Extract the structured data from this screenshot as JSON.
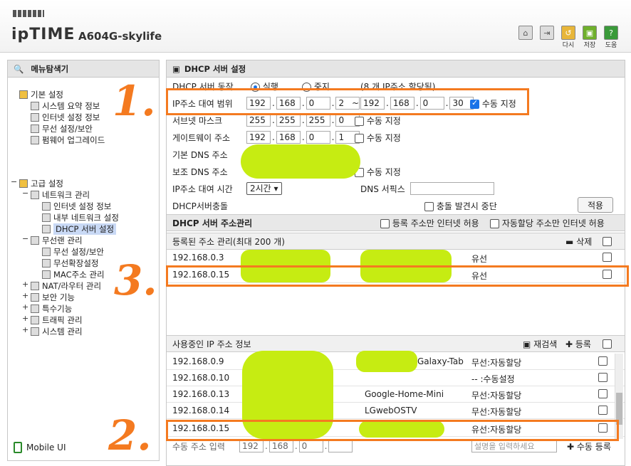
{
  "header": {
    "brand": "ipTIME",
    "model": "A604G-skylife",
    "icons": [
      "home-icon",
      "logout-icon"
    ],
    "buttons": [
      {
        "icon": "undo-icon",
        "label": "다시",
        "color": "#e8b63a"
      },
      {
        "icon": "save-icon",
        "label": "저장",
        "color": "#6fb02c"
      },
      {
        "icon": "help-icon",
        "label": "도움",
        "color": "#3a9a3a"
      }
    ]
  },
  "sidebar": {
    "title": "메뉴탐색기",
    "basic": {
      "label": "기본 설정",
      "items": [
        "시스템 요약 정보",
        "인터넷 설정 정보",
        "무선 설정/보안",
        "펌웨어 업그레이드"
      ]
    },
    "advanced": {
      "label": "고급 설정",
      "network": {
        "label": "네트워크 관리",
        "items": [
          "인터넷 설정 정보",
          "내부 네트워크 설정",
          "DHCP 서버 설정"
        ]
      },
      "wireless": {
        "label": "무선랜 관리",
        "items": [
          "무선 설정/보안",
          "무선확장설정",
          "MAC주소 관리"
        ]
      },
      "others": [
        "NAT/라우터 관리",
        "보안 기능",
        "특수기능",
        "트래픽 관리",
        "시스템 관리"
      ]
    },
    "mobile": "Mobile UI"
  },
  "dhcp": {
    "title": "DHCP 서버 설정",
    "server_label": "DHCP 서버 동작",
    "run": "실행",
    "stop": "중지",
    "assigned": "(8 개 IP주소 할당됨)",
    "range_label": "IP주소 대여 범위",
    "range_start": [
      "192",
      "168",
      "0",
      "2"
    ],
    "range_end": [
      "192",
      "168",
      "0",
      "30"
    ],
    "tilde": "~",
    "manual": "수동 지정",
    "subnet_label": "서브넷 마스크",
    "subnet": [
      "255",
      "255",
      "255",
      "0"
    ],
    "gateway_label": "게이트웨이 주소",
    "gateway": [
      "192",
      "168",
      "0",
      "1"
    ],
    "dns1_label": "기본 DNS 주소",
    "dns2_label": "보조 DNS 주소",
    "lease_label": "IP주소 대여 시간",
    "lease_value": "2시간",
    "dns_suffix_label": "DNS 서픽스",
    "conflict_label": "DHCP서버충돌",
    "conflict_stop": "충돌 발견시 중단",
    "apply": "적용"
  },
  "addr_mgmt": {
    "title": "DHCP 서버 주소관리",
    "allow_registered": "등록 주소만 인터넷 허용",
    "allow_auto": "자동할당 주소만 인터넷 허용",
    "registered_header": "등록된 주소 관리(최대 200 개)",
    "delete": "삭제",
    "registered": [
      {
        "ip": "192.168.0.3",
        "type": "유선"
      },
      {
        "ip": "192.168.0.15",
        "type": "유선"
      }
    ],
    "inuse_header": "사용중인 IP 주소 정보",
    "rescan": "재검색",
    "register": "등록",
    "inuse": [
      {
        "ip": "192.168.0.9",
        "name": "Galaxy-Tab",
        "type": "무선:자동할당"
      },
      {
        "ip": "192.168.0.10",
        "name": "",
        "type": "-- :수동설정"
      },
      {
        "ip": "192.168.0.13",
        "name": "Google-Home-Mini",
        "type": "무선:자동할당"
      },
      {
        "ip": "192.168.0.14",
        "name": "LGwebOSTV",
        "type": "무선:자동할당"
      },
      {
        "ip": "192.168.0.15",
        "name": "",
        "type": "유선:자동할당"
      }
    ],
    "manual_input_label": "수동 주소 입력",
    "manual_ip": [
      "192",
      "168",
      "0"
    ],
    "desc_placeholder": "설명을 입력하세요",
    "manual_register": "수동 등록"
  },
  "annotations": {
    "color": "#f47a20",
    "n1": "1.",
    "n2": "2.",
    "n3": "3."
  }
}
